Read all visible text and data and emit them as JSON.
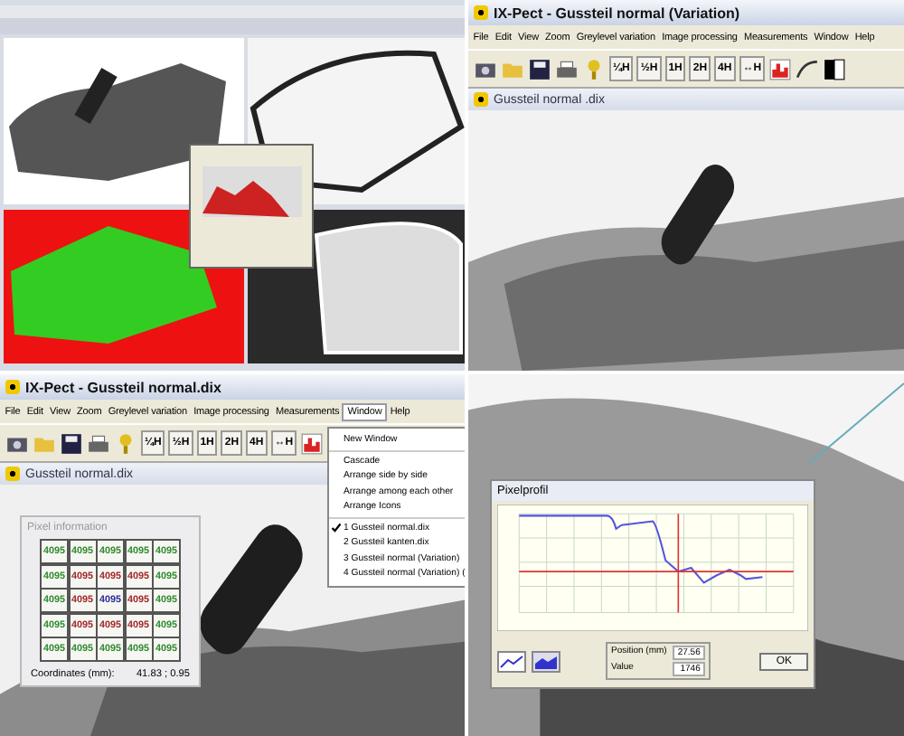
{
  "top_right_window": {
    "title": "IX-Pect - Gussteil normal (Variation)",
    "menu": [
      "File",
      "Edit",
      "View",
      "Zoom",
      "Greylevel variation",
      "Image processing",
      "Measurements",
      "Window",
      "Help"
    ],
    "zoom_buttons": [
      "¼H",
      "½H",
      "1H",
      "2H",
      "4H",
      "↔H"
    ],
    "document_title": "Gussteil normal .dix"
  },
  "bottom_left_window": {
    "title": "IX-Pect - Gussteil normal.dix",
    "menu": [
      {
        "label": "File",
        "selected": false
      },
      {
        "label": "Edit",
        "selected": false
      },
      {
        "label": "View",
        "selected": false
      },
      {
        "label": "Zoom",
        "selected": false
      },
      {
        "label": "Greylevel variation",
        "selected": false
      },
      {
        "label": "Image processing",
        "selected": false
      },
      {
        "label": "Measurements",
        "selected": false
      },
      {
        "label": "Window",
        "selected": true
      },
      {
        "label": "Help",
        "selected": false
      }
    ],
    "zoom_buttons": [
      "¼H",
      "½H",
      "1H",
      "2H",
      "4H",
      "↔H"
    ],
    "document_title": "Gussteil normal.dix",
    "window_menu": [
      [
        {
          "label": "New Window",
          "checked": false
        }
      ],
      [
        {
          "label": "Cascade",
          "checked": false
        },
        {
          "label": "Arrange side by side",
          "checked": false
        },
        {
          "label": "Arrange among each other",
          "checked": false
        },
        {
          "label": "Arrange Icons",
          "checked": false
        }
      ],
      [
        {
          "label": "1 Gussteil normal.dix",
          "checked": true
        },
        {
          "label": "2 Gussteil kanten.dix",
          "checked": false
        },
        {
          "label": "3 Gussteil normal (Variation)",
          "checked": false
        },
        {
          "label": "4 Gussteil normal (Variation) (",
          "checked": false
        }
      ]
    ],
    "pixel_information": {
      "title": "Pixel information",
      "rows": [
        [
          {
            "value": "4095",
            "color": "#2e8b2e"
          },
          {
            "value": "4095",
            "color": "#2e8b2e"
          },
          {
            "value": "4095",
            "color": "#2e8b2e"
          },
          {
            "value": "4095",
            "color": "#2e8b2e"
          },
          {
            "value": "4095",
            "color": "#2e8b2e"
          }
        ],
        [
          {
            "value": "4095",
            "color": "#2e8b2e"
          },
          {
            "value": "4095",
            "color": "#a02828"
          },
          {
            "value": "4095",
            "color": "#a02828"
          },
          {
            "value": "4095",
            "color": "#a02828"
          },
          {
            "value": "4095",
            "color": "#2e8b2e"
          }
        ],
        [
          {
            "value": "4095",
            "color": "#2e8b2e"
          },
          {
            "value": "4095",
            "color": "#a02828"
          },
          {
            "value": "4095",
            "color": "#2a2a9a"
          },
          {
            "value": "4095",
            "color": "#a02828"
          },
          {
            "value": "4095",
            "color": "#2e8b2e"
          }
        ],
        [
          {
            "value": "4095",
            "color": "#2e8b2e"
          },
          {
            "value": "4095",
            "color": "#a02828"
          },
          {
            "value": "4095",
            "color": "#a02828"
          },
          {
            "value": "4095",
            "color": "#a02828"
          },
          {
            "value": "4095",
            "color": "#2e8b2e"
          }
        ],
        [
          {
            "value": "4095",
            "color": "#2e8b2e"
          },
          {
            "value": "4095",
            "color": "#2e8b2e"
          },
          {
            "value": "4095",
            "color": "#2e8b2e"
          },
          {
            "value": "4095",
            "color": "#2e8b2e"
          },
          {
            "value": "4095",
            "color": "#2e8b2e"
          }
        ]
      ],
      "coordinates_label": "Coordinates (mm):",
      "coordinates_value": "41.83 ; 0.95"
    }
  },
  "pixel_profile": {
    "title": "Pixelprofil",
    "position_label": "Position (mm)",
    "position_value": "27.56",
    "value_label": "Value",
    "value_value": "1746",
    "ok_button": "OK"
  }
}
